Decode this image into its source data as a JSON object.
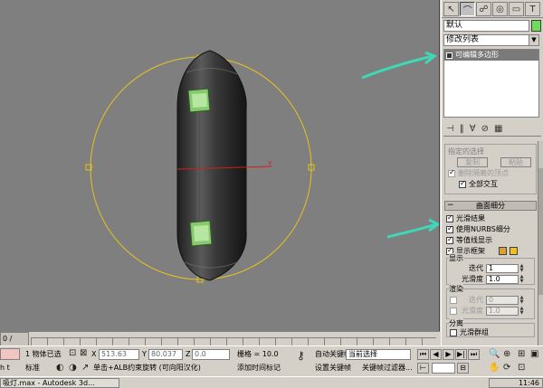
{
  "viewport": {
    "label": ""
  },
  "command_panel": {
    "tabs": [
      {
        "icon": "pointer-icon"
      },
      {
        "icon": "modify-bend-icon"
      },
      {
        "icon": "hierarchy-icon"
      },
      {
        "icon": "motion-icon"
      },
      {
        "icon": "display-icon"
      },
      {
        "icon": "utilities-hammer-icon"
      }
    ],
    "object_name": "默认",
    "object_color": "#6edc5a",
    "modifier_list": "修改列表",
    "stack_item": "可编辑多边形"
  },
  "selection_rollout": {
    "title": "指定的选择",
    "copy": "复制",
    "paste": "粘贴",
    "delete_isolated": "删除隔离的顶点",
    "full_interactivity": "全部交互"
  },
  "subdivision": {
    "title": "曲面细分",
    "smooth_result": "光滑结果",
    "use_nurms": "使用NURBS细分",
    "isoline_display": "等值线显示",
    "show_cage": "显示框架",
    "cage_colors": [
      "#e0a030",
      "#f0c020"
    ],
    "display_group": "显示",
    "iterations_label": "迭代",
    "iterations_value": "1",
    "smoothness_label": "光滑度",
    "smoothness_value": "1.0",
    "render_group": "渲染",
    "render_iterations_label": "迭代",
    "render_iterations_value": "0",
    "render_smoothness_label": "光滑度",
    "render_smoothness_value": "1.0",
    "separate_group": "分离",
    "smoothing_groups": "光滑群组"
  },
  "trackbar": {
    "frame": "0 / 100"
  },
  "status": {
    "objects_selected": "1 物体已选",
    "x_label": "X",
    "x_value": "513.63",
    "y_label": "Y",
    "y_value": "80.037",
    "z_label": "Z",
    "z_value": "0.0",
    "grid": "栅格 = 10.0",
    "auto_key": "自动关键帧",
    "set_key": "设置关键帧",
    "selection_set": "当前选择",
    "key_filters": "关键帧过滤器...",
    "prompt": "单击+ALB约束旋转 (可向阳汉化)",
    "add_time_tag": "添加时间标记",
    "left_mini": "标准",
    "left_mini2": "h t"
  },
  "taskbar": {
    "app_title": "吸灯.max - Autodesk 3d...",
    "clock": "11:46"
  }
}
